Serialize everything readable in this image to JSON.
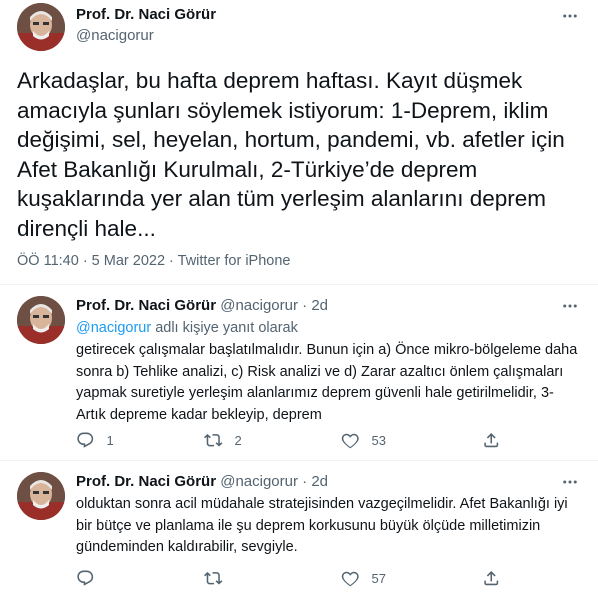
{
  "main": {
    "name": "Prof. Dr. Naci Görür",
    "handle": "@nacigorur",
    "text": "Arkadaşlar, bu hafta deprem haftası. Kayıt düşmek amacıyla şunları söylemek istiyorum: 1-Deprem, iklim değişimi, sel, heyelan, hortum, pandemi, vb. afetler için Afet Bakanlığı Kurulmalı, 2-Türkiye’de deprem kuşaklarında yer alan tüm yerleşim alanlarını deprem dirençli hale...",
    "meta": "ÖÖ 11:40 · 5 Mar 2022 · Twitter for iPhone"
  },
  "replies": [
    {
      "name": "Prof. Dr. Naci Görür",
      "handle": "@nacigorur",
      "dot": "·",
      "time": "2d",
      "replying_mention": "@nacigorur",
      "replying_suffix": " adlı kişiye yanıt olarak",
      "text": "getirecek çalışmalar başlatılmalıdır. Bunun için a) Önce mikro-bölgeleme daha sonra b) Tehlike analizi, c) Risk analizi ve d) Zarar azaltıcı önlem çalışmaları yapmak suretiyle   yerleşim alanlarımız deprem güvenli hale getirilmelidir, 3-Artık depreme kadar bekleyip, deprem",
      "reply_count": "1",
      "retweet_count": "2",
      "like_count": "53"
    },
    {
      "name": "Prof. Dr. Naci Görür",
      "handle": "@nacigorur",
      "dot": "·",
      "time": "2d",
      "text": "olduktan sonra acil müdahale stratejisinden vazgeçilmelidir. Afet Bakanlığı iyi bir bütçe ve planlama ile şu deprem korkusunu büyük ölçüde milletimizin gündeminden kaldırabilir, sevgiyle.",
      "reply_count": "",
      "retweet_count": "",
      "like_count": "57"
    }
  ],
  "colors": {
    "text": "#0f1419",
    "secondary": "#536471",
    "link": "#1d9bf0",
    "divider": "#eff3f4"
  },
  "icons": [
    "more-icon",
    "reply-icon",
    "retweet-icon",
    "like-icon",
    "share-icon"
  ]
}
